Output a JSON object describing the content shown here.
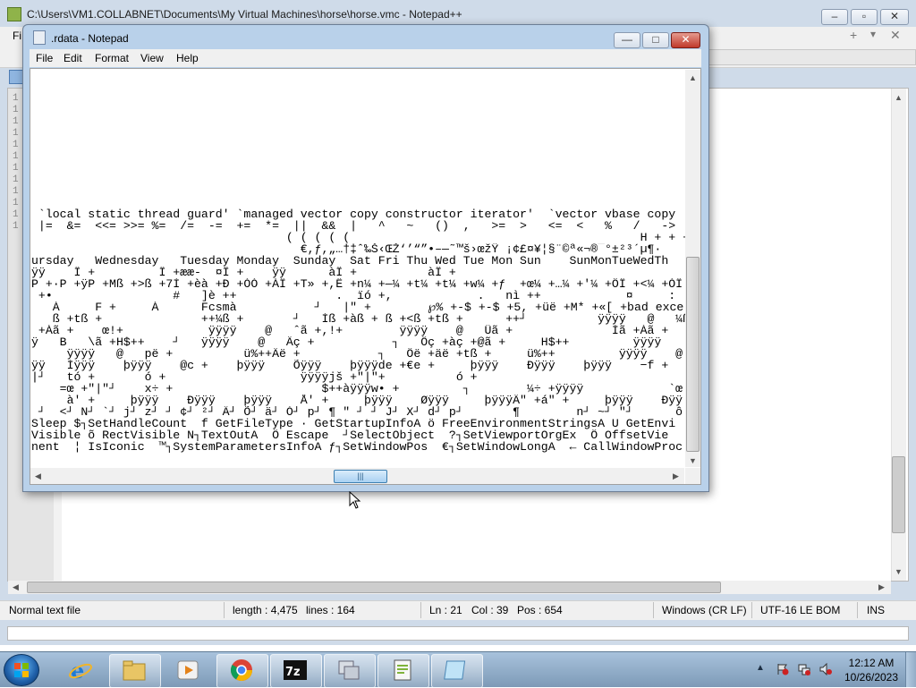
{
  "npp": {
    "title": "C:\\Users\\VM1.COLLABNET\\Documents\\My Virtual Machines\\horse\\horse.vmc - Notepad++",
    "menu_first": "Fi",
    "line_numbers": [
      "1",
      "1",
      "1",
      "1",
      "1",
      "1",
      "1",
      "1",
      "1",
      "1",
      "1",
      "1"
    ],
    "status": {
      "file_type": "Normal text file",
      "length": "length : 4,475",
      "lines": "lines : 164",
      "ln": "Ln : 21",
      "col": "Col : 39",
      "pos": "Pos : 654",
      "eol": "Windows (CR LF)",
      "encoding": "UTF-16 LE BOM",
      "mode": "INS"
    }
  },
  "notepad": {
    "title": ".rdata - Notepad",
    "menu": [
      "File",
      "Edit",
      "Format",
      "View",
      "Help"
    ],
    "buttons": {
      "minimize": "—",
      "maximize": "□",
      "close": "✕"
    },
    "text_lines": [
      " `local static thread guard' `managed vector copy constructor iterator'  `vector vbase copy",
      " |=  &=  <<= >>= %=  /=  -=  +=  *=  ||  &&  |   ^   ~   ()  ,   >=  >   <=  <   %   /   ->",
      "                                    ( ( ( ( (                                         H + + + +",
      "                                      €,ƒ,„…†‡ˆ‰Š‹ŒŽ‘’“”•–—˜™š›œžŸ ¡¢£¤¥¦§¨©ª«¬­®¯°±²³´µ¶·",
      "ursday   Wednesday   Tuesday Monday  Sunday  Sat Fri Thu Wed Tue Mon Sun    SunMonTueWedTh",
      "ÿÿ    Ï +         Ï +ææ-  ¤Ï +    ÿÿ      àÏ +          àÏ +",
      "P +·P +ÿP +Mß +>ß +7Í +èà +Ð +ÓÓ +ÀÏ +T» +,Ë +n¼ +—¼ +t¼ +t¼ +w¼ +ƒ  +œ¼ +…¼ +'¼ +ÔÏ +<¼ +ÒÏ +—¼ +-¼",
      " +•                 #   ]è ++              .  ïó +,            .   nì ++            ¤     :",
      "   À     F +     À      Fcsmà           ┘   |\" +        ℘% +-$ +-$ +5, +üë +M* +«[ +bad exce",
      "   ß +tß +              ++¼ß +       ┘   Ìß +àß + ß +<ß +tß +      ++┘          ÿÿÿÿ   @   ¼ß +",
      " +Àã +    œ!+            ÿÿÿÿ    @   ˆã +,!+        ÿÿÿÿ    @   Üã +              Ìã +Àã +    Ü!++",
      "ÿ   B   \\ã +H$++    ┘   ÿÿÿÿ    @   Äç +           ┐   Ôç +àç +@ã +     H$++         ÿÿÿÿ    @",
      "     ÿÿÿÿ   @   pë +          ü%++Äë +           ┐   Ôë +äë +tß +     ü%++         ÿÿÿÿ    @",
      "ÿÿ   Ìÿÿÿ    þÿÿÿ    @c +    þÿÿÿ    Õÿÿÿ    þÿÿÿde +€e +     þÿÿÿ    Ðÿÿÿ    þÿÿÿ    −f +",
      "|┘   tó +       ó +                   ÿÿÿÿjš +\"|\"+          ó +                                 ô",
      "    =œ +\"|\"┘    x÷ +                     $++àÿÿÿw• +         ┐        ¼÷ +ÿÿÿÿ            `œ",
      "     à' +     þÿÿÿ    Ðÿÿÿ    þÿÿÿ    Å' +     þÿÿÿ    Øÿÿÿ     þÿÿÿÄ\" +á\" +     þÿÿÿ    Ðÿÿ",
      " ┘  <┘ N┘ `┘ j┘ z┘ ┘ ¢┘ ²┘ Ä┘ Õ┘ ä┘ Ò┘ p┘ ¶ \" ┘ ┘ J┘ X┘ d┘ p┘       ¶        n┘ ~┘ \"┘      ô",
      "Sleep $┐SetHandleCount  f GetFileType · GetStartupInfoA ö FreeEnvironmentStringsA U GetEnvi",
      "Visible õ RectVisible N┐TextOutA  Ö Escape  ┘SelectObject  ?┐SetViewportOrgEx  Ô OffsetVie",
      "nent  ¦ IsIconic  ™┐SystemParametersInfoA ƒ┐SetWindowPos  €┐SetWindowLongA  ← CallWindowProc"
    ]
  },
  "taskbar": {
    "apps": [
      "start-orb",
      "internet-explorer",
      "windows-explorer",
      "media-player",
      "chrome",
      "7-zip",
      "vmware",
      "notepad-plus-plus",
      "notepad"
    ],
    "clock_time": "12:12 AM",
    "clock_date": "10/26/2023"
  },
  "colors": {
    "window_frame": "#b9d1ea",
    "close_red": "#c0382a",
    "taskbar": "#8fabc8"
  }
}
